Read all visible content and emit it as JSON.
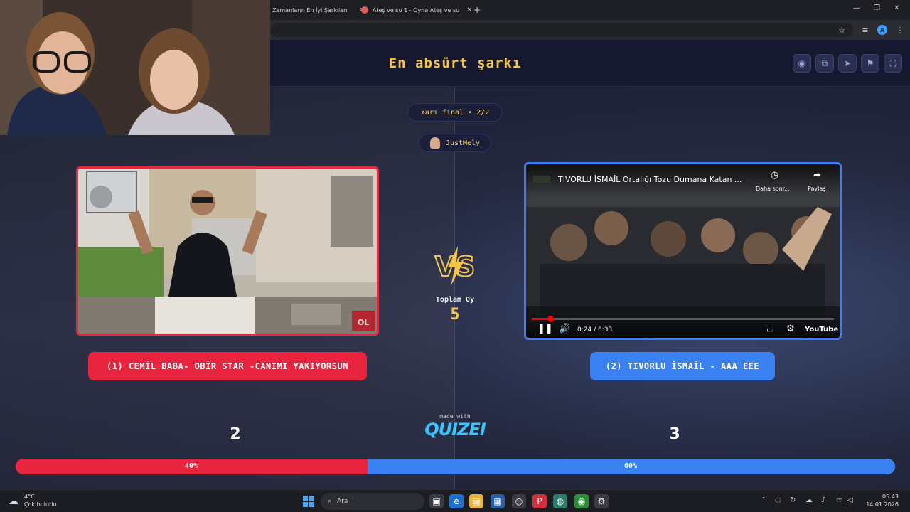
{
  "browser": {
    "tabs": [
      {
        "label": "Zamanların En İyi Şarkıları"
      },
      {
        "label": "Ateş ve su 1 - Oyna Ateş ve su"
      }
    ],
    "new_tab": "+",
    "profile_initial": "A"
  },
  "quiz": {
    "title": "En absürt şarkı",
    "round": "Yarı final • 2/2",
    "username": "JustMely",
    "vs_label": "VS",
    "total_label": "Toplam Oy",
    "total_votes": "5",
    "made_with": "made with",
    "brand": "QUIZEI"
  },
  "left": {
    "choice_label": "(1) CEMİL BABA- OBİR STAR -CANIMI YAKIYORSUN",
    "votes": "2",
    "percent_label": "40%",
    "fraction": 0.4,
    "watermark": "OL"
  },
  "right": {
    "video_title": "TIVORLU İSMAİL Ortalığı Tozu Dumana Katan ...",
    "watch_later": "Daha sonr...",
    "share": "Paylaş",
    "time": "0:24 / 6:33",
    "playback_fraction": 0.061,
    "youtube": "YouTube",
    "choice_label": "(2) TIVORLU İSMAİL - AAA EEE",
    "votes": "3",
    "percent_label": "60%",
    "fraction": 0.6
  },
  "colors": {
    "red": "#e8243f",
    "blue": "#3a82f2",
    "gold": "#f6c54a",
    "brand": "#39c6ff"
  },
  "taskbar": {
    "weather_temp": "4°C",
    "weather_desc": "Çok bulutlu",
    "search_placeholder": "Ara",
    "time": "05:43",
    "date": "14.01.2026"
  }
}
